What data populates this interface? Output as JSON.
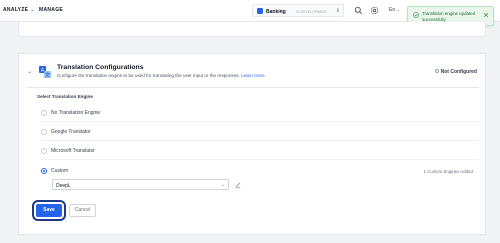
{
  "topbar": {
    "nav": [
      {
        "label": "ANALYZE",
        "icon": "chevron-down-icon"
      },
      {
        "label": "MANAGE"
      }
    ],
    "app_switcher": {
      "app_name": "Banking",
      "env_label": "IN DEVELOPMENT",
      "icon": "app-logo-icon"
    },
    "icons": [
      "search-icon",
      "settings-icon"
    ],
    "language": "En"
  },
  "toast": {
    "message": "Translation engine updated successfully",
    "icon": "success-check-icon",
    "close_icon": "close-icon",
    "color": "#1f6a3a"
  },
  "section": {
    "title": "Translation Configurations",
    "description": "Configure the translation engine to be used for translating the user input or the responses.",
    "learn_more": "Learn more",
    "status": "Not Configured",
    "group_label": "Select Translation Engine",
    "options": [
      {
        "label": "No Translation Engine",
        "checked": false
      },
      {
        "label": "Google Translator",
        "checked": false
      },
      {
        "label": "Microsoft Translator",
        "checked": false
      },
      {
        "label": "Custom",
        "checked": true
      }
    ],
    "custom_engines_added": "1 Custom Engines Added",
    "custom_engine_select": {
      "value": "DeepL"
    }
  },
  "actions": {
    "save_label": "Save",
    "cancel_label": "Cancel"
  },
  "colors": {
    "accent": "#2563eb",
    "toast_bg": "#e8f6ec"
  }
}
